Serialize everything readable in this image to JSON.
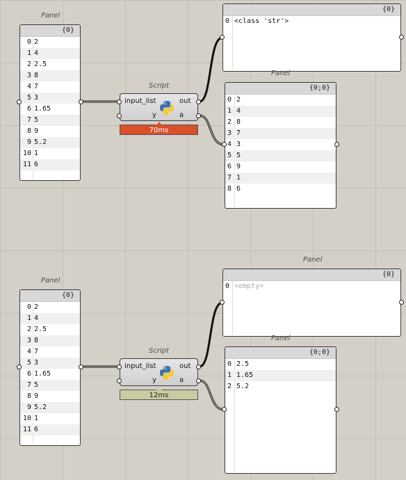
{
  "top": {
    "input_panel": {
      "caption": "Panel",
      "header": "{0}",
      "rows": [
        {
          "index": "0",
          "value": "2"
        },
        {
          "index": "1",
          "value": "4"
        },
        {
          "index": "2",
          "value": "2.5"
        },
        {
          "index": "3",
          "value": "8"
        },
        {
          "index": "4",
          "value": "7"
        },
        {
          "index": "5",
          "value": "3"
        },
        {
          "index": "6",
          "value": "1.65"
        },
        {
          "index": "7",
          "value": "5"
        },
        {
          "index": "8",
          "value": "9"
        },
        {
          "index": "9",
          "value": "5.2"
        },
        {
          "index": "10",
          "value": "1"
        },
        {
          "index": "11",
          "value": "6"
        }
      ]
    },
    "script": {
      "caption": "Script",
      "input_x": "input_list",
      "input_y": "y",
      "output_out": "out",
      "output_a": "a",
      "timer": "70ms",
      "timer_color": "#d9502a"
    },
    "out_panel": {
      "header": "{0}",
      "rows": [
        {
          "index": "0",
          "value": "<class 'str'>"
        }
      ]
    },
    "a_panel": {
      "caption": "Panel",
      "header": "{0;0}",
      "rows": [
        {
          "index": "0",
          "value": "2"
        },
        {
          "index": "1",
          "value": "4"
        },
        {
          "index": "2",
          "value": "8"
        },
        {
          "index": "3",
          "value": "7"
        },
        {
          "index": "4",
          "value": "3"
        },
        {
          "index": "5",
          "value": "5"
        },
        {
          "index": "6",
          "value": "9"
        },
        {
          "index": "7",
          "value": "1"
        },
        {
          "index": "8",
          "value": "6"
        }
      ]
    }
  },
  "bottom": {
    "input_panel": {
      "caption": "Panel",
      "header": "{0}",
      "rows": [
        {
          "index": "0",
          "value": "2"
        },
        {
          "index": "1",
          "value": "4"
        },
        {
          "index": "2",
          "value": "2.5"
        },
        {
          "index": "3",
          "value": "8"
        },
        {
          "index": "4",
          "value": "7"
        },
        {
          "index": "5",
          "value": "3"
        },
        {
          "index": "6",
          "value": "1.65"
        },
        {
          "index": "7",
          "value": "5"
        },
        {
          "index": "8",
          "value": "9"
        },
        {
          "index": "9",
          "value": "5.2"
        },
        {
          "index": "10",
          "value": "1"
        },
        {
          "index": "11",
          "value": "6"
        }
      ]
    },
    "script": {
      "caption": "Script",
      "input_x": "input_list",
      "input_y": "y",
      "output_out": "out",
      "output_a": "a",
      "timer": "12ms",
      "timer_color": "#c9cca0"
    },
    "out_panel": {
      "caption": "Panel",
      "header": "{0}",
      "rows": [
        {
          "index": "0",
          "value": "<empty>"
        }
      ]
    },
    "a_panel": {
      "caption": "Panel",
      "header": "{0;0}",
      "rows": [
        {
          "index": "0",
          "value": "2.5"
        },
        {
          "index": "1",
          "value": "1.65"
        },
        {
          "index": "2",
          "value": "5.2"
        }
      ]
    }
  },
  "icons": {
    "python": "python-logo-icon",
    "grip": "circle-grip-icon"
  }
}
